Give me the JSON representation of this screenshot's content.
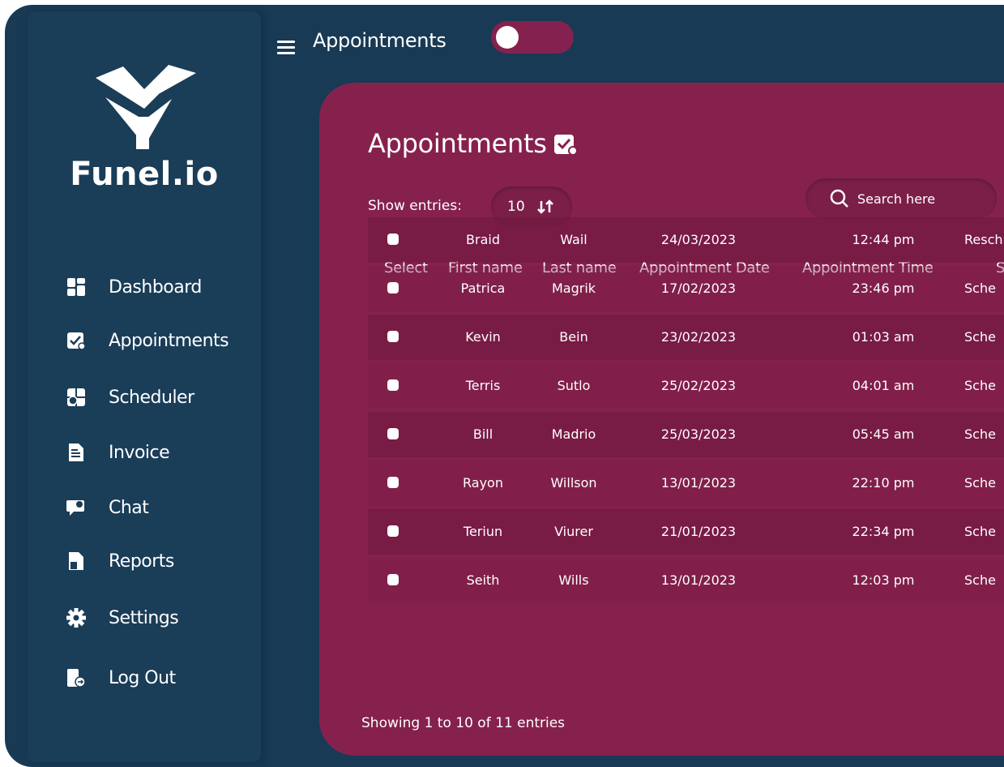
{
  "brand": {
    "name": "Funel.io"
  },
  "sidebar": {
    "items": [
      {
        "label": "Dashboard",
        "icon": "dashboard-icon"
      },
      {
        "label": "Appointments",
        "icon": "appointments-icon"
      },
      {
        "label": "Scheduler",
        "icon": "scheduler-icon"
      },
      {
        "label": "Invoice",
        "icon": "invoice-icon"
      },
      {
        "label": "Chat",
        "icon": "chat-icon"
      },
      {
        "label": "Reports",
        "icon": "reports-icon"
      },
      {
        "label": "Settings",
        "icon": "gear-icon"
      },
      {
        "label": "Log Out",
        "icon": "logout-icon"
      }
    ]
  },
  "header": {
    "title": "Appointments",
    "theme_toggle": "off"
  },
  "panel": {
    "title": "Appointments",
    "show_entries_label": "Show entries:",
    "entries_value": "10",
    "search_placeholder": "Search here",
    "footer": "Showing 1 to 10 of 11 entries"
  },
  "table": {
    "columns": [
      "Select",
      "First name",
      "Last name",
      "Appointment Date",
      "Appointment Time",
      "St"
    ],
    "rows": [
      {
        "first": "Braid",
        "last": "Wail",
        "date": "24/03/2023",
        "time": "12:44 pm",
        "status": "Resch"
      },
      {
        "first": "Patrica",
        "last": "Magrik",
        "date": "17/02/2023",
        "time": "23:46 pm",
        "status": "Sche"
      },
      {
        "first": "Kevin",
        "last": "Bein",
        "date": "23/02/2023",
        "time": "01:03 am",
        "status": "Sche"
      },
      {
        "first": "Terris",
        "last": "Sutlo",
        "date": "25/02/2023",
        "time": "04:01 am",
        "status": "Sche"
      },
      {
        "first": "Bill",
        "last": "Madrio",
        "date": "25/03/2023",
        "time": "05:45 am",
        "status": "Sche"
      },
      {
        "first": "Rayon",
        "last": "Willson",
        "date": "13/01/2023",
        "time": "22:10 pm",
        "status": "Sche"
      },
      {
        "first": "Teriun",
        "last": "Viurer",
        "date": "21/01/2023",
        "time": "22:34 pm",
        "status": "Sche"
      },
      {
        "first": "Seith",
        "last": "Wills",
        "date": "13/01/2023",
        "time": "12:03 pm",
        "status": "Sche"
      }
    ]
  },
  "colors": {
    "navy": "#183a55",
    "sidebar": "#1a3d58",
    "magenta": "#86214e"
  }
}
